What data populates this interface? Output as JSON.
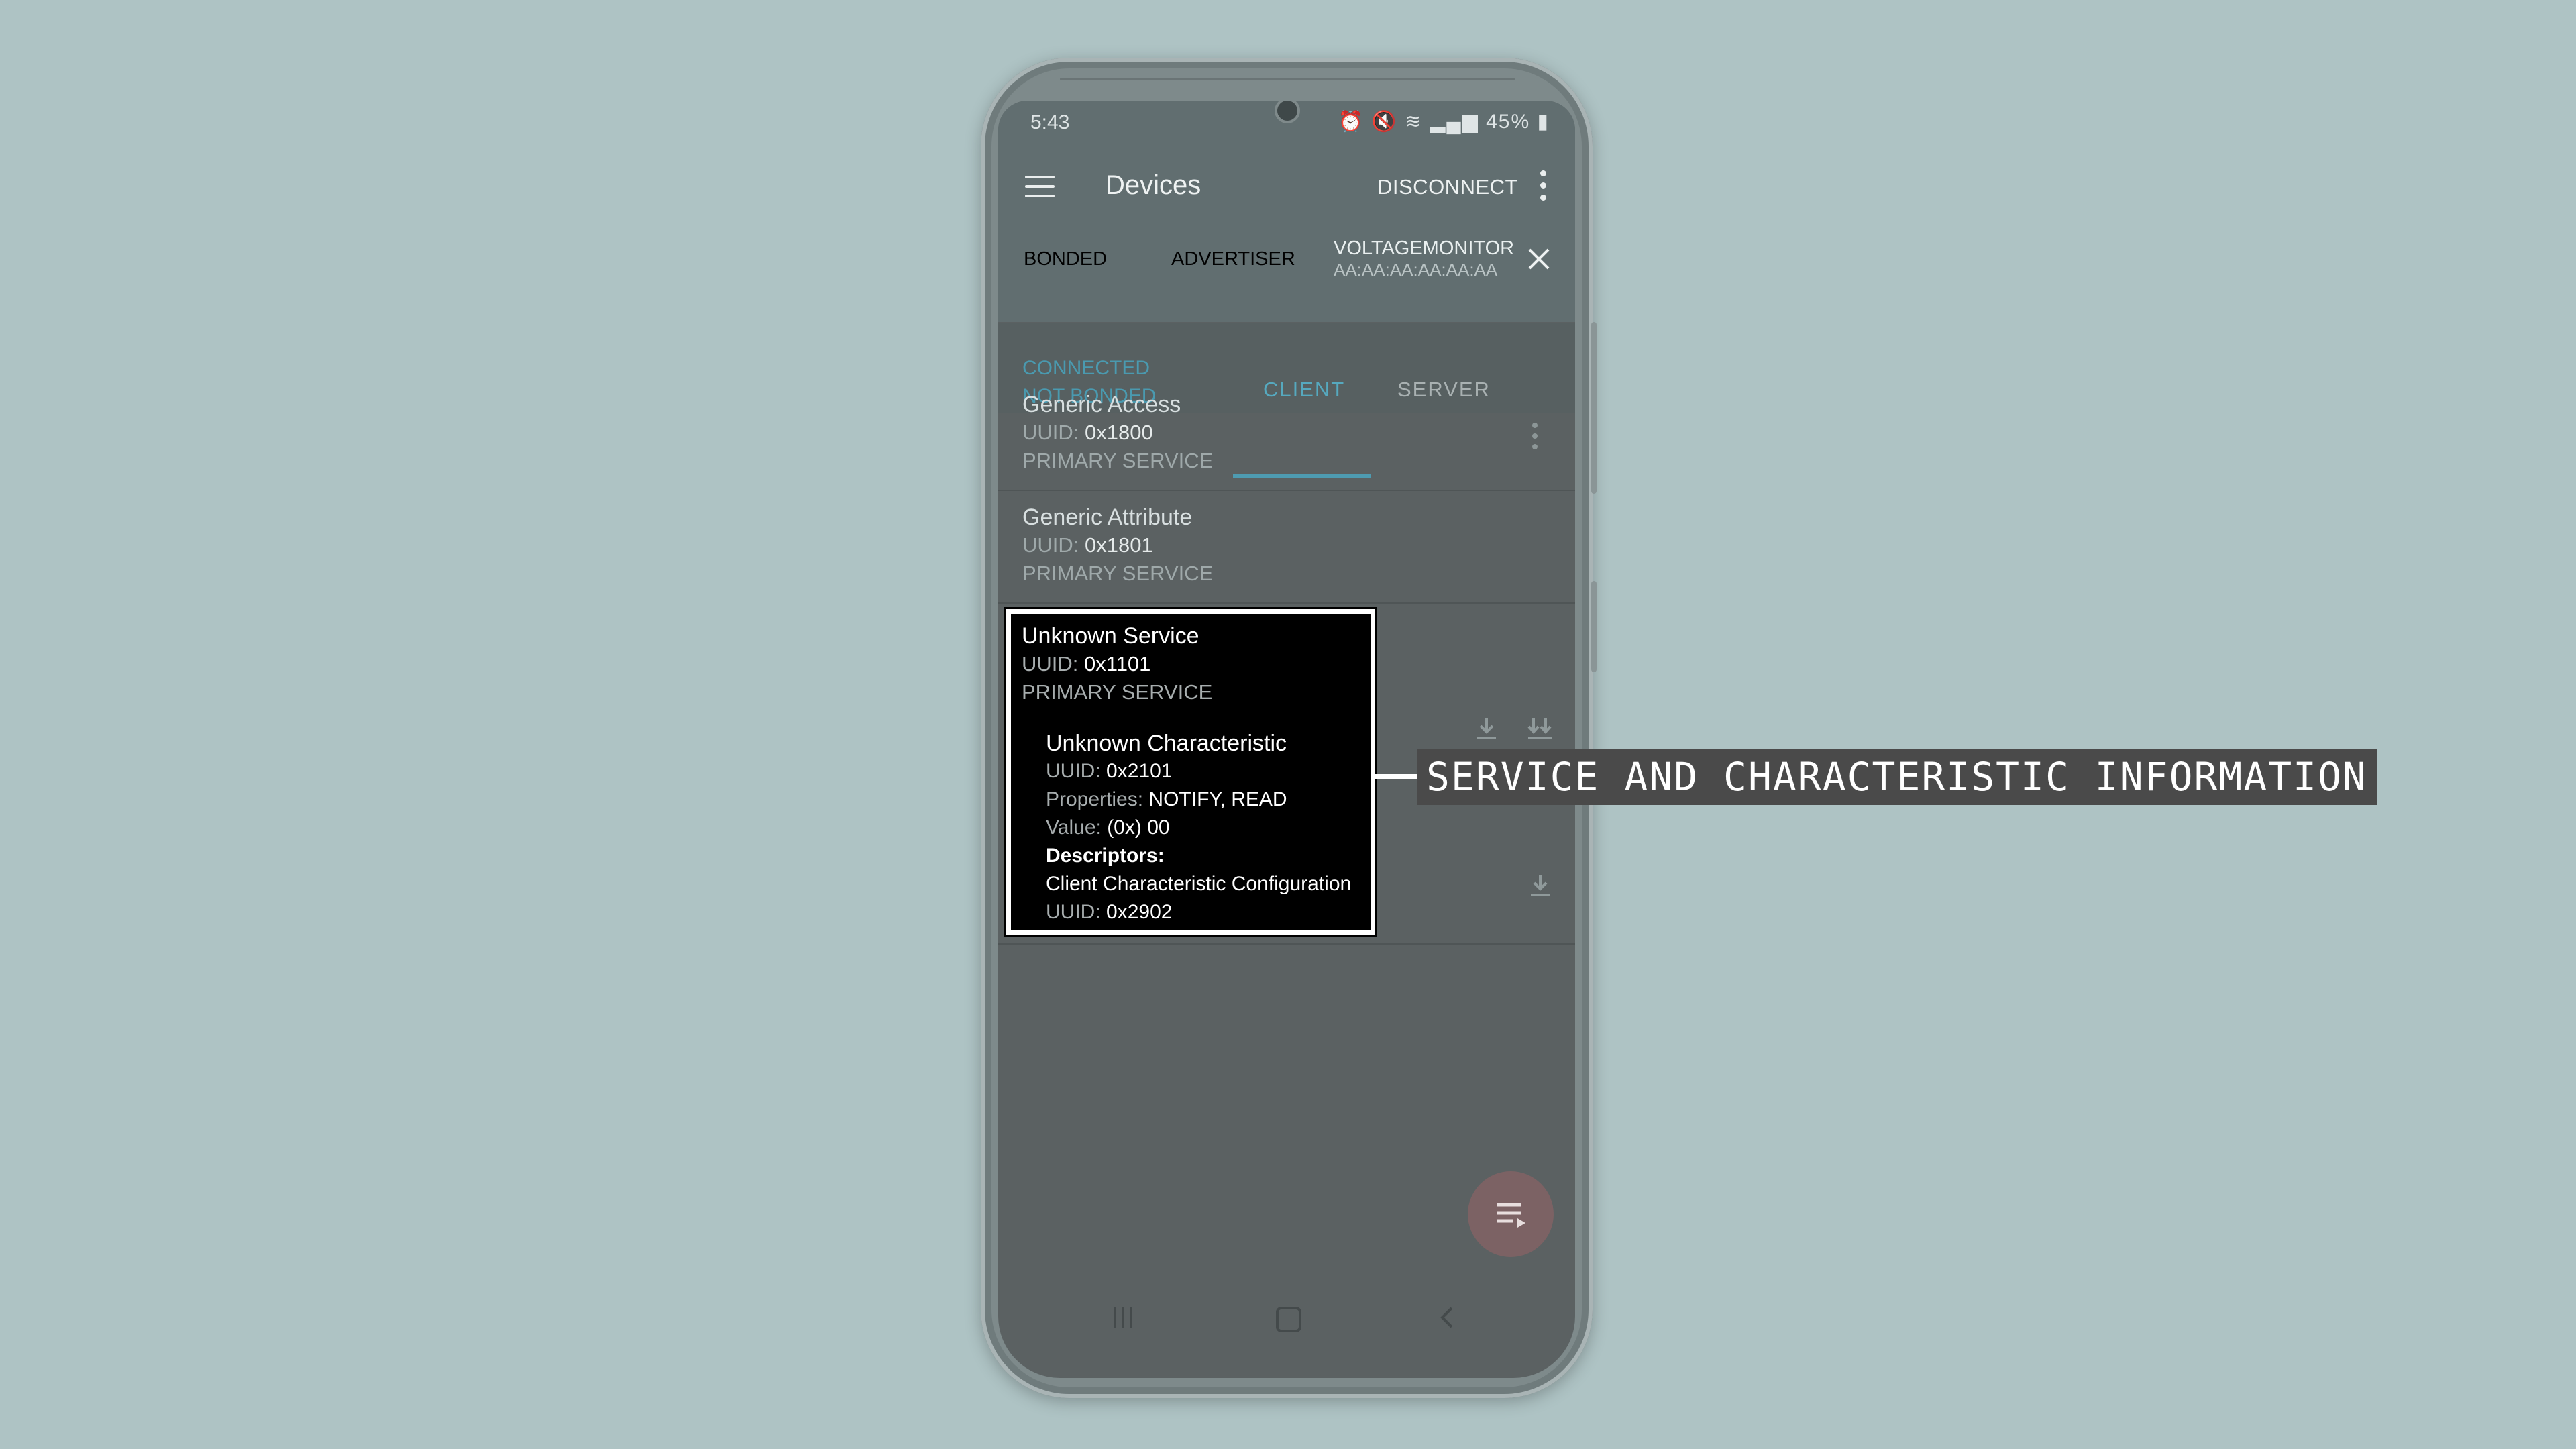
{
  "status_bar": {
    "time": "5:43",
    "battery": "45%",
    "icons": [
      "alarm-icon",
      "mute-icon",
      "wifi-icon",
      "volte-icon",
      "signal-icon",
      "battery-icon"
    ]
  },
  "app_bar": {
    "title": "Devices",
    "disconnect_label": "DISCONNECT"
  },
  "device_tabs": {
    "bonded": "BONDED",
    "advertiser": "ADVERTISER",
    "device_name": "VOLTAGEMONITOR",
    "device_address": "AA:AA:AA:AA:AA:AA"
  },
  "connection": {
    "state": "CONNECTED",
    "bond_state": "NOT BONDED"
  },
  "role_tabs": {
    "client": "CLIENT",
    "server": "SERVER",
    "active": "CLIENT"
  },
  "services": [
    {
      "name": "Generic Access",
      "uuid_label": "UUID:",
      "uuid": "0x1800",
      "type": "PRIMARY SERVICE"
    },
    {
      "name": "Generic Attribute",
      "uuid_label": "UUID:",
      "uuid": "0x1801",
      "type": "PRIMARY SERVICE"
    },
    {
      "name": "Unknown Service",
      "uuid_label": "UUID:",
      "uuid": "0x1101",
      "type": "PRIMARY SERVICE",
      "characteristic": {
        "name": "Unknown Characteristic",
        "uuid_label": "UUID:",
        "uuid": "0x2101",
        "properties_label": "Properties:",
        "properties": "NOTIFY, READ",
        "value_label": "Value:",
        "value": "(0x) 00",
        "descriptors_label": "Descriptors:",
        "descriptor_name": "Client Characteristic Configuration",
        "descriptor_uuid_label": "UUID:",
        "descriptor_uuid": "0x2902"
      }
    }
  ],
  "callout": {
    "label": "SERVICE AND CHARACTERISTIC INFORMATION"
  },
  "colors": {
    "background": "#aec3c4",
    "accent": "#4e9bb1",
    "highlight_border": "#ffffff",
    "callout_bg": "#4a4a4a",
    "fab": "#7c6264"
  }
}
